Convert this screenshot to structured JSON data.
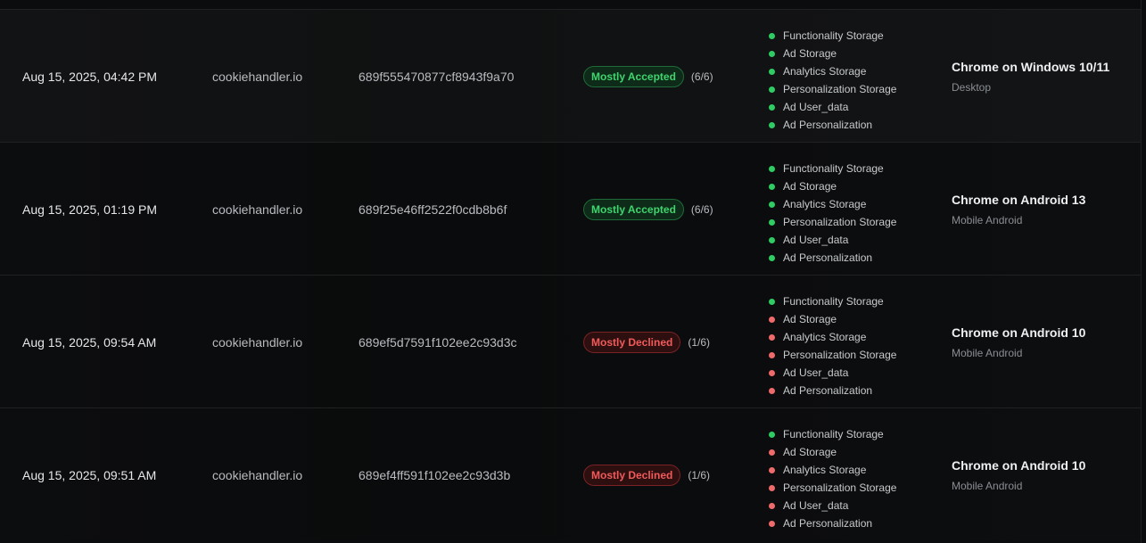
{
  "rows": [
    {
      "date": "Aug 15, 2025, 04:42 PM",
      "domain": "cookiehandler.io",
      "consent_id": "689f555470877cf8943f9a70",
      "status": "Mostly Accepted",
      "status_color": "#3fd56e",
      "count": "(6/6)",
      "categories": [
        {
          "label": "Functionality Storage",
          "state": "granted"
        },
        {
          "label": "Ad Storage",
          "state": "granted"
        },
        {
          "label": "Analytics Storage",
          "state": "granted"
        },
        {
          "label": "Personalization Storage",
          "state": "granted"
        },
        {
          "label": "Ad User_data",
          "state": "granted"
        },
        {
          "label": "Ad Personalization",
          "state": "granted"
        }
      ],
      "device_name": "Chrome on Windows 10/11",
      "device_type": "Desktop"
    },
    {
      "date": "Aug 15, 2025, 01:19 PM",
      "domain": "cookiehandler.io",
      "consent_id": "689f25e46ff2522f0cdb8b6f",
      "status": "Mostly Accepted",
      "status_color": "#3fd56e",
      "count": "(6/6)",
      "categories": [
        {
          "label": "Functionality Storage",
          "state": "granted"
        },
        {
          "label": "Ad Storage",
          "state": "granted"
        },
        {
          "label": "Analytics Storage",
          "state": "granted"
        },
        {
          "label": "Personalization Storage",
          "state": "granted"
        },
        {
          "label": "Ad User_data",
          "state": "granted"
        },
        {
          "label": "Ad Personalization",
          "state": "granted"
        }
      ],
      "device_name": "Chrome on Android 13",
      "device_type": "Mobile Android"
    },
    {
      "date": "Aug 15, 2025, 09:54 AM",
      "domain": "cookiehandler.io",
      "consent_id": "689ef5d7591f102ee2c93d3c",
      "status": "Mostly Declined",
      "status_color": "#f05a5a",
      "count": "(1/6)",
      "categories": [
        {
          "label": "Functionality Storage",
          "state": "granted"
        },
        {
          "label": "Ad Storage",
          "state": "denied"
        },
        {
          "label": "Analytics Storage",
          "state": "denied"
        },
        {
          "label": "Personalization Storage",
          "state": "denied"
        },
        {
          "label": "Ad User_data",
          "state": "denied"
        },
        {
          "label": "Ad Personalization",
          "state": "denied"
        }
      ],
      "device_name": "Chrome on Android 10",
      "device_type": "Mobile Android"
    },
    {
      "date": "Aug 15, 2025, 09:51 AM",
      "domain": "cookiehandler.io",
      "consent_id": "689ef4ff591f102ee2c93d3b",
      "status": "Mostly Declined",
      "status_color": "#f05a5a",
      "count": "(1/6)",
      "categories": [
        {
          "label": "Functionality Storage",
          "state": "granted"
        },
        {
          "label": "Ad Storage",
          "state": "denied"
        },
        {
          "label": "Analytics Storage",
          "state": "denied"
        },
        {
          "label": "Personalization Storage",
          "state": "denied"
        },
        {
          "label": "Ad User_data",
          "state": "denied"
        },
        {
          "label": "Ad Personalization",
          "state": "denied"
        }
      ],
      "device_name": "Chrome on Android 10",
      "device_type": "Mobile Android"
    }
  ],
  "colors": {
    "granted": "#2ecc63",
    "denied": "#ef6a6a",
    "background": "#0b0c0d"
  }
}
